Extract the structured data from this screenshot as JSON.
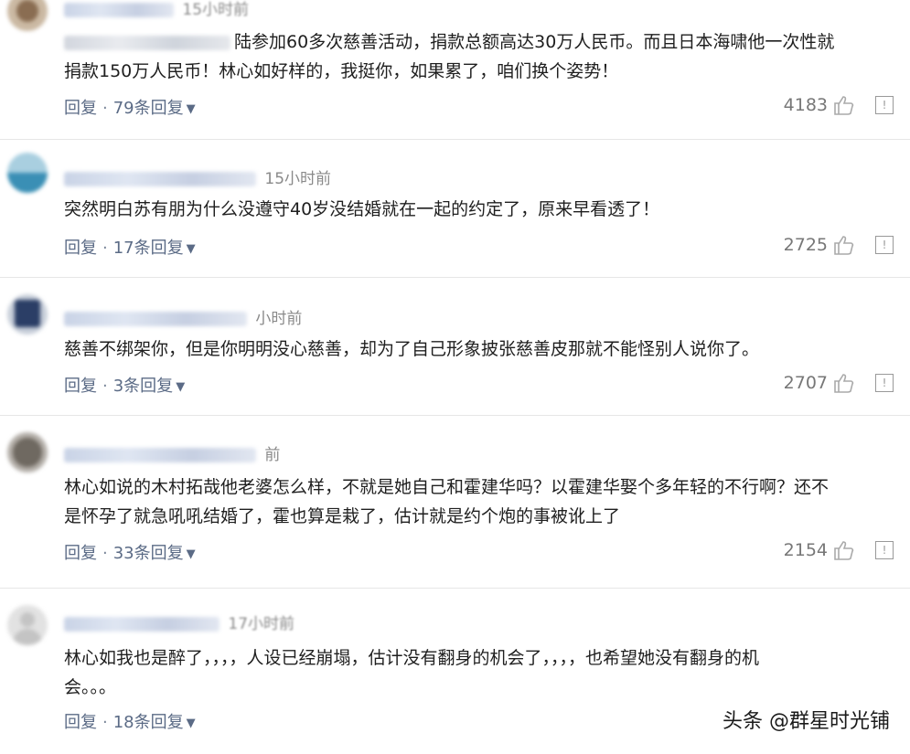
{
  "comments": [
    {
      "time": "15小时前",
      "text_line1": "陆参加60多次慈善活动，捐款总额高达30万人民币。而且日本海啸他一次性就",
      "text_line2": "捐款150万人民币！林心如好样的，我挺你，如果累了，咱们换个姿势！",
      "reply": "回复",
      "sep": "·",
      "replies": "79条回复",
      "likes": "4183"
    },
    {
      "time": "15小时前",
      "text_line1": "突然明白苏有朋为什么没遵守40岁没结婚就在一起的约定了，原来早看透了！",
      "reply": "回复",
      "sep": "·",
      "replies": "17条回复",
      "likes": "2725"
    },
    {
      "time": "小时前",
      "text_line1": "慈善不绑架你，但是你明明没心慈善，却为了自己形象披张慈善皮那就不能怪别人说你了。",
      "reply": "回复",
      "sep": "·",
      "replies": "3条回复",
      "likes": "2707"
    },
    {
      "time": "前",
      "text_line1": "林心如说的木村拓哉他老婆怎么样，不就是她自己和霍建华吗？以霍建华娶个多年轻的不行啊？还不",
      "text_line2": "是怀孕了就急吼吼结婚了，霍也算是栽了，估计就是约个炮的事被讹上了",
      "reply": "回复",
      "sep": "·",
      "replies": "33条回复",
      "likes": "2154"
    },
    {
      "time": "17小时前",
      "text_line1": "林心如我也是醉了，，，，人设已经崩塌，估计没有翻身的机会了，，，，也希望她没有翻身的机",
      "text_line2": "会。。。",
      "reply": "回复",
      "sep": "·",
      "replies": "18条回复"
    }
  ],
  "watermark": "头条 @群星时光铺",
  "icons": {
    "like": "thumbs-up-icon",
    "report": "report-icon",
    "chevron": "chevron-down-icon"
  },
  "colors": {
    "action_blue": "#5b6b86",
    "meta_gray": "#8a8a8a",
    "divider": "#e6e6e6"
  }
}
